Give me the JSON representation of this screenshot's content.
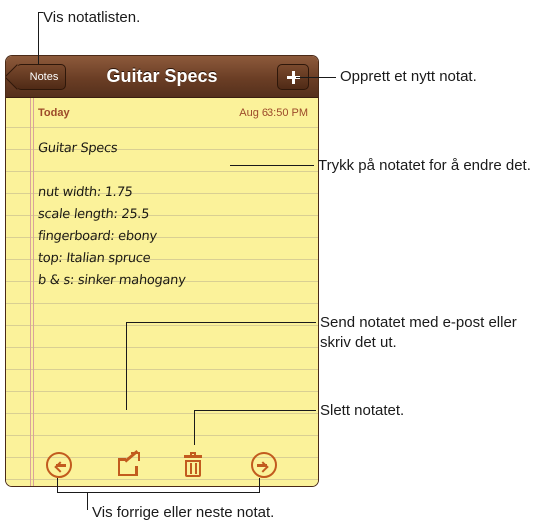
{
  "app": {
    "nav": {
      "back_label": "Notes",
      "title": "Guitar Specs"
    },
    "meta": {
      "day_label": "Today",
      "date": "Aug 6",
      "time": "3:50 PM"
    },
    "note_lines": [
      "Guitar Specs",
      "",
      "nut width:  1.75",
      "scale length:  25.5",
      "fingerboard:  ebony",
      "top:  Italian spruce",
      "b & s:  sinker mahogany"
    ],
    "toolbar": {
      "prev_icon": "previous-arrow-icon",
      "share_icon": "share-icon",
      "trash_icon": "trash-icon",
      "next_icon": "next-arrow-icon"
    },
    "colors": {
      "nav_brown": "#6b3e25",
      "paper_yellow": "#fbf29a",
      "icon_orange": "#c25b1e",
      "accent_red": "#9c4a2a"
    }
  },
  "callouts": {
    "show_list": "Vis notatlisten.",
    "new_note": "Opprett et nytt notat.",
    "tap_edit": "Trykk på notatet for å endre det.",
    "email_print": "Send notatet med e-post eller skriv det ut.",
    "delete": "Slett notatet.",
    "prev_next": "Vis forrige eller neste notat."
  }
}
